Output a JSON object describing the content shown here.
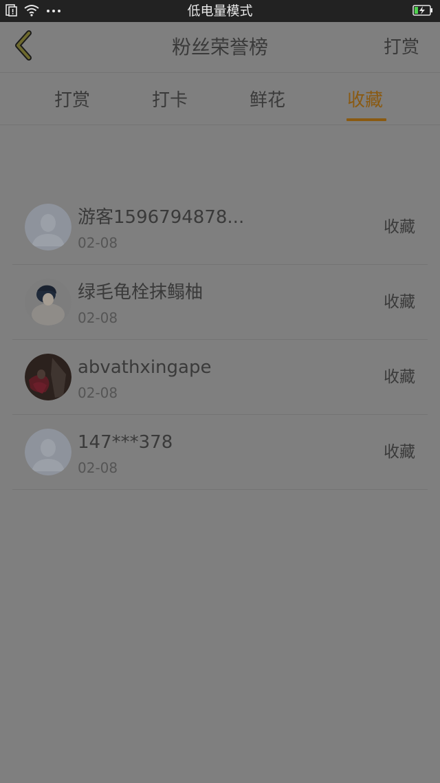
{
  "status_bar": {
    "title": "低电量模式",
    "icons": [
      "sim-icon",
      "wifi-icon",
      "more-dots-icon",
      "battery-charging-icon"
    ]
  },
  "nav": {
    "back_icon": "chevron-left-icon",
    "title": "粉丝荣誉榜",
    "action_label": "打赏"
  },
  "tabs": [
    {
      "label": "打赏",
      "active": false
    },
    {
      "label": "打卡",
      "active": false
    },
    {
      "label": "鲜花",
      "active": false
    },
    {
      "label": "收藏",
      "active": true
    }
  ],
  "list": [
    {
      "name": "游客1596794878...",
      "date": "02-08",
      "action": "收藏",
      "avatar": "default-avatar"
    },
    {
      "name": "绿毛龟栓抹鳎柚",
      "date": "02-08",
      "action": "收藏",
      "avatar": "photo-avatar-character"
    },
    {
      "name": "abvathxingape",
      "date": "02-08",
      "action": "收藏",
      "avatar": "photo-avatar-red"
    },
    {
      "name": "147***378",
      "date": "02-08",
      "action": "收藏",
      "avatar": "default-avatar"
    }
  ],
  "colors": {
    "accent": "#8a5a12",
    "overlay_background": "#7f7f7f",
    "status_bar": "#222222"
  }
}
